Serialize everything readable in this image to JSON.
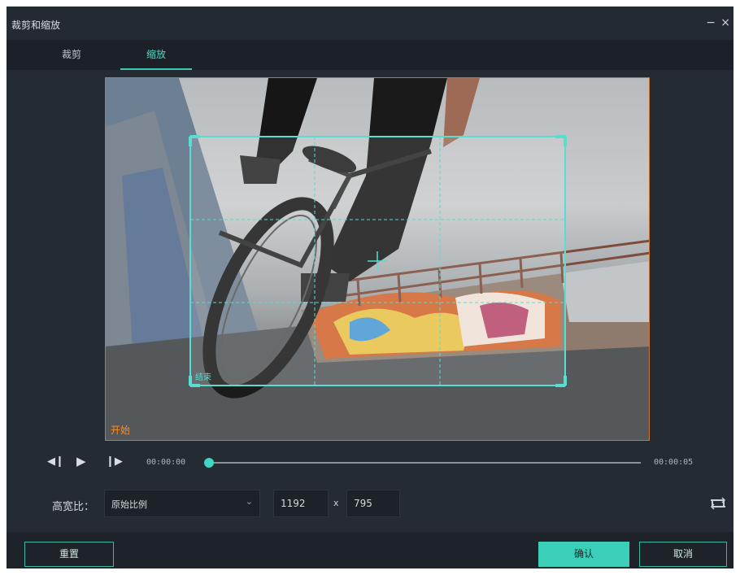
{
  "window": {
    "title": "裁剪和缩放",
    "minimize_label": "−",
    "close_label": "×"
  },
  "tabs": [
    {
      "label": "裁剪",
      "active": false
    },
    {
      "label": "缩放",
      "active": true
    }
  ],
  "preview": {
    "start_label": "开始",
    "end_label": "结束"
  },
  "playback": {
    "current_time": "00:00:00",
    "end_time": "00:00:05",
    "progress": 0
  },
  "aspect": {
    "label": "高宽比：",
    "selected": "原始比例",
    "width": "1192",
    "times": "x",
    "height": "795"
  },
  "buttons": {
    "reset": "重置",
    "ok": "确认",
    "cancel": "取消"
  },
  "colors": {
    "accent": "#3bcfb9",
    "start_label": "#ff8a1e",
    "background": "#242b33"
  },
  "icons": {
    "prev_frame": "prev-frame-icon",
    "play": "play-icon",
    "next_frame": "next-frame-icon",
    "chevron": "chevron-down-icon",
    "swap": "swap-aspect-icon"
  }
}
